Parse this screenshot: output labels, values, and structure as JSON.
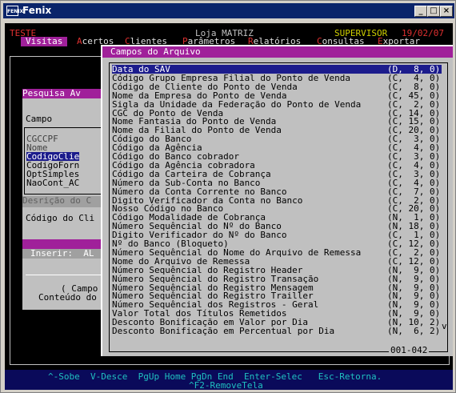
{
  "window": {
    "title": "Fenix",
    "icon_label": "FENIX",
    "min_label": "_",
    "max_label": "□",
    "close_label": "×"
  },
  "status": {
    "left": "TESTE",
    "store": "Loja MATRIZ",
    "user": "SUPERVISOR",
    "date": "19/02/07"
  },
  "menu": [
    {
      "hk": "",
      "rest": "Visitas",
      "selected": true
    },
    {
      "hk": "A",
      "rest": "certos"
    },
    {
      "hk": "C",
      "rest": "lientes"
    },
    {
      "hk": "P",
      "rest": "arâmetros"
    },
    {
      "hk": "R",
      "rest": "elatórios"
    },
    {
      "hk": "C",
      "rest": "onsultas"
    },
    {
      "hk": "E",
      "rest": "xportar"
    }
  ],
  "background": {
    "pesquisa_title": "Pesquisa Av",
    "campo_label": "Campo",
    "campo_items": [
      "CGCCPF",
      "Nome",
      "CodigoClie",
      "CodigoForn",
      "OptSimples",
      "NaoCont_AC"
    ],
    "descricao": "Desrição do C",
    "codigo": "Código do Cli",
    "inserir": "Inserir:  AL",
    "campo_paren": "( Campo",
    "conteudo": "Conteúdo do"
  },
  "popup": {
    "title": "Campos do Arquivo",
    "counter": "001-042",
    "scroll_indicator": "v",
    "rows": [
      {
        "label": "Data do SAV",
        "value": "(D,  8, 0)",
        "selected": true
      },
      {
        "label": "Código Grupo Empresa Filial do Ponto de Venda",
        "value": "(C,  4, 0)"
      },
      {
        "label": "Código de Cliente do Ponto de Venda",
        "value": "(C,  8, 0)"
      },
      {
        "label": "Nome da Empresa do Ponto de Venda",
        "value": "(C, 45, 0)"
      },
      {
        "label": "Sigla da Unidade da Federação do Ponto de Venda",
        "value": "(C,  2, 0)"
      },
      {
        "label": "CGC do Ponto de Venda",
        "value": "(C, 14, 0)"
      },
      {
        "label": "Nome Fantasia do Ponto de Venda",
        "value": "(C, 15, 0)"
      },
      {
        "label": "Nome da Filial do Ponto de Venda",
        "value": "(C, 20, 0)"
      },
      {
        "label": "Código do Banco",
        "value": "(C,  3, 0)"
      },
      {
        "label": "Código da Agência",
        "value": "(C,  4, 0)"
      },
      {
        "label": "Código do Banco cobrador",
        "value": "(C,  3, 0)"
      },
      {
        "label": "Código da Agência cobradora",
        "value": "(C,  4, 0)"
      },
      {
        "label": "Código da Carteira de Cobrança",
        "value": "(C,  3, 0)"
      },
      {
        "label": "Número da Sub-Conta no Banco",
        "value": "(C,  4, 0)"
      },
      {
        "label": "Número da Conta Corrente no Banco",
        "value": "(C,  7, 0)"
      },
      {
        "label": "Digito Verificador da Conta no Banco",
        "value": "(C,  2, 0)"
      },
      {
        "label": "Nosso Código no Banco",
        "value": "(C, 20, 0)"
      },
      {
        "label": "Código Modalidade de Cobrança",
        "value": "(N,  1, 0)"
      },
      {
        "label": "Número Sequêncial do Nº do Banco",
        "value": "(N, 18, 0)"
      },
      {
        "label": "Digito Verificador do Nº do Banco",
        "value": "(C,  1, 0)"
      },
      {
        "label": "Nº do Banco (Bloqueto)",
        "value": "(C, 12, 0)"
      },
      {
        "label": "Número Sequêncial do Nome do Arquivo de Remessa",
        "value": "(C,  2, 0)"
      },
      {
        "label": "Nome do Arquivo de Remessa",
        "value": "(C, 12, 0)"
      },
      {
        "label": "Número Sequêncial do Registro Header",
        "value": "(N,  9, 0)"
      },
      {
        "label": "Número Sequêncial do Registro Transação",
        "value": "(N,  9, 0)"
      },
      {
        "label": "Número Sequêncial do Registro Mensagem",
        "value": "(N,  9, 0)"
      },
      {
        "label": "Número Sequêncial do Registro Trailler",
        "value": "(N,  9, 0)"
      },
      {
        "label": "Número Sequêncial dos Registros - Geral",
        "value": "(N,  9, 0)"
      },
      {
        "label": "Valor Total dos Títulos Remetidos",
        "value": "(N,  9, 0)"
      },
      {
        "label": "Desconto Bonificação em Valor por Dia",
        "value": "(N, 10, 2)"
      },
      {
        "label": "Desconto Bonificação em Percentual por Dia",
        "value": "(N,  6, 2)"
      }
    ]
  },
  "footer": {
    "line1": "^-Sobe  V-Desce  PgUp Home PgDn End  Enter-Selec   Esc-Retorna.",
    "line2": "^F2-RemoveTela"
  }
}
